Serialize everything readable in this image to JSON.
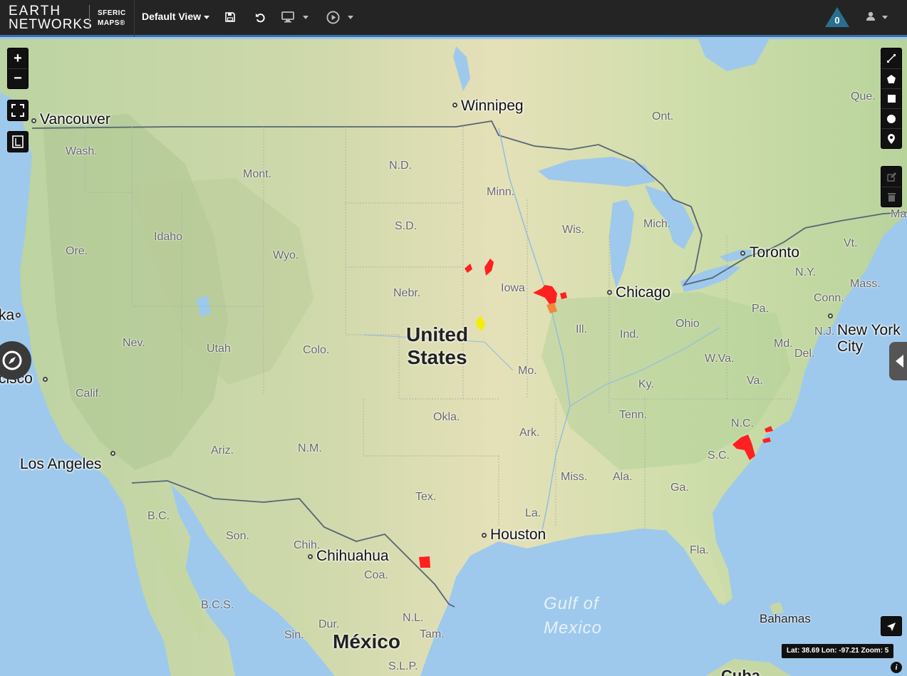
{
  "header": {
    "logo_line1": "EARTH",
    "logo_line2": "NETWORKS",
    "product_line1": "SFERIC",
    "product_line2": "MAPS®",
    "view_label": "Default View",
    "alert_count": "0"
  },
  "icons": {
    "save": "save-icon",
    "undo": "undo-icon",
    "display": "monitor-icon",
    "play": "play-icon",
    "alerts": "warning-triangle-icon",
    "user": "user-icon"
  },
  "controls": {
    "zoom_in": "+",
    "zoom_out": "−"
  },
  "map": {
    "cities": {
      "vancouver": "Vancouver",
      "winnipeg": "Winnipeg",
      "toronto": "Toronto",
      "chicago": "Chicago",
      "new_york_1": "New York",
      "new_york_2": "City",
      "los_angeles": "Los Angeles",
      "houston": "Houston",
      "chihuahua": "Chihuahua",
      "san_francisco_partial": "cisco",
      "partial_ka": "ka"
    },
    "countries": {
      "us_line1": "United",
      "us_line2": "States",
      "mexico": "México",
      "cuba": "Cuba"
    },
    "water": {
      "gulf_line1": "Gulf of",
      "gulf_line2": "Mexico"
    },
    "regions": {
      "wash": "Wash.",
      "ore": "Ore.",
      "calif": "Calif.",
      "idaho": "Idaho",
      "mont": "Mont.",
      "nev": "Nev.",
      "utah": "Utah",
      "wyo": "Wyo.",
      "colo": "Colo.",
      "ariz": "Ariz.",
      "nm": "N.M.",
      "nd": "N.D.",
      "sd": "S.D.",
      "nebr": "Nebr.",
      "okla": "Okla.",
      "tex": "Tex.",
      "minn": "Minn.",
      "iowa": "Iowa",
      "mo": "Mo.",
      "ark": "Ark.",
      "la": "La.",
      "wis": "Wis.",
      "ill": "Ill.",
      "mich": "Mich.",
      "ind": "Ind.",
      "ohio": "Ohio",
      "ky": "Ky.",
      "tenn": "Tenn.",
      "miss": "Miss.",
      "ala": "Ala.",
      "ga": "Ga.",
      "fla": "Fla.",
      "sc": "S.C.",
      "nc": "N.C.",
      "va": "Va.",
      "wva": "W.Va.",
      "pa": "Pa.",
      "ny": "N.Y.",
      "nj": "N.J.",
      "md": "Md.",
      "del": "Del.",
      "conn": "Conn.",
      "mass": "Mass.",
      "vt": "Vt.",
      "ma_partial": "Ma",
      "ont": "Ont.",
      "que": "Que.",
      "bc": "B.C.",
      "son": "Son.",
      "chih": "Chih.",
      "coa": "Coa.",
      "bcs": "B.C.S.",
      "nl": "N.L.",
      "tam": "Tam.",
      "sin": "Sin.",
      "dur": "Dur.",
      "slp": "S.L.P.",
      "bahamas": "Bahamas"
    }
  },
  "status": {
    "coords": "Lat: 38.69 Lon: -97.21 Zoom: 5",
    "info": "i"
  },
  "colors": {
    "topbar": "#242424",
    "accent": "#3a6ea5",
    "alert_badge": "#2a6f8f",
    "storm_red": "#ff2020",
    "storm_orange": "#f08a3a",
    "storm_yellow": "#f2f000"
  }
}
